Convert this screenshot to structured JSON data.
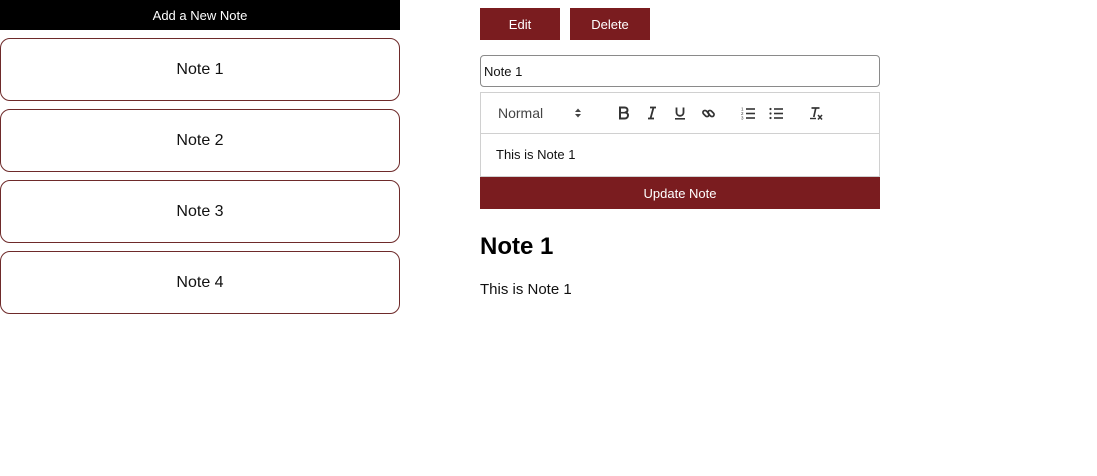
{
  "sidebar": {
    "add_button_label": "Add a New Note",
    "notes": [
      {
        "title": "Note 1"
      },
      {
        "title": "Note 2"
      },
      {
        "title": "Note 3"
      },
      {
        "title": "Note 4"
      }
    ]
  },
  "editor": {
    "edit_label": "Edit",
    "delete_label": "Delete",
    "title_value": "Note 1",
    "format_selected": "Normal",
    "toolbar_icons": [
      "bold-icon",
      "italic-icon",
      "underline-icon",
      "link-icon",
      "ordered-list-icon",
      "bullet-list-icon",
      "clear-format-icon"
    ],
    "body_text": "This is Note 1",
    "update_label": "Update Note"
  },
  "preview": {
    "title": "Note 1",
    "body": "This is Note 1"
  },
  "colors": {
    "accent": "#7a1c1f",
    "add_button_bg": "#000000",
    "card_border": "#6e2a2a"
  }
}
